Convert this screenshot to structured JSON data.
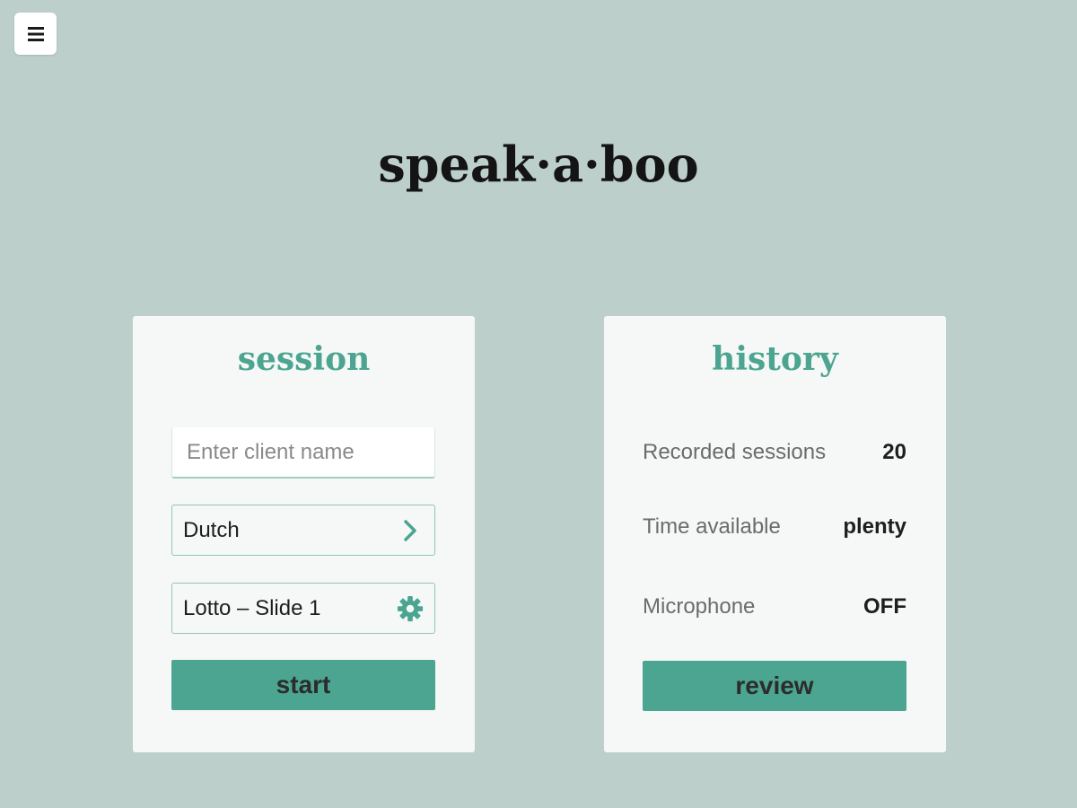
{
  "menu": {
    "icon": "hamburger-menu-icon"
  },
  "app": {
    "logo_text": "speak·a·boo"
  },
  "session": {
    "title": "session",
    "client_name_placeholder": "Enter client name",
    "client_name_value": "",
    "language": {
      "value": "Dutch",
      "icon": "chevron-right-icon"
    },
    "material": {
      "value": "Lotto – Slide 1",
      "icon": "gear-icon"
    },
    "start_label": "start"
  },
  "history": {
    "title": "history",
    "stats": [
      {
        "label": "Recorded sessions",
        "value": "20"
      },
      {
        "label": "Time available",
        "value": "plenty"
      },
      {
        "label": "Microphone",
        "value": "OFF"
      }
    ],
    "review_label": "review"
  },
  "colors": {
    "background": "#bccfcb",
    "accent": "#4ba590",
    "card": "#f6f8f7"
  }
}
